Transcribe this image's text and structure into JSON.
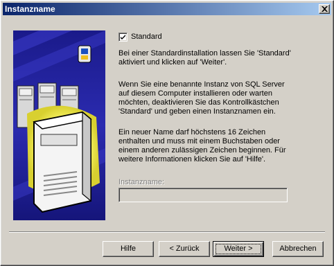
{
  "window": {
    "title": "Instanzname"
  },
  "checkbox": {
    "label": "Standard",
    "checked": true
  },
  "paragraphs": {
    "p1": "Bei einer Standardinstallation lassen Sie 'Standard'\naktiviert und klicken auf 'Weiter'.",
    "p2": "Wenn Sie eine benannte Instanz von SQL Server\nauf diesem Computer installieren oder warten\nmöchten, deaktivieren Sie das Kontrollkästchen\n'Standard' und geben einen Instanznamen ein.",
    "p3": "Ein neuer Name darf höchstens 16 Zeichen\nenthalten und muss mit einem Buchstaben oder\neinem anderen zulässigen Zeichen beginnen. Für\nweitere Informationen klicken Sie auf 'Hilfe'."
  },
  "instance": {
    "label": "Instanzname:",
    "value": ""
  },
  "buttons": {
    "help": "Hilfe",
    "back": "< Zurück",
    "next": "Weiter >",
    "cancel": "Abbrechen"
  },
  "icons": {
    "close": "close-icon",
    "check": "checkmark-icon",
    "art": "server-illustration"
  }
}
